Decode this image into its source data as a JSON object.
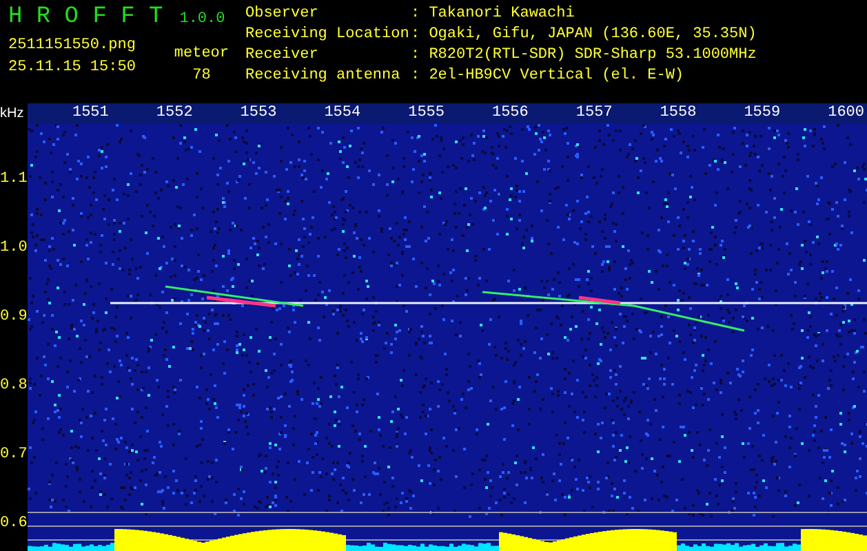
{
  "app": {
    "title": "H R O F F T",
    "version": "1.0.0"
  },
  "file": {
    "name": "2511151550.png",
    "datetime": "25.11.15 15:50"
  },
  "counter": {
    "label": "meteor",
    "count": "78"
  },
  "info": [
    {
      "label": "Observer",
      "value": ": Takanori Kawachi"
    },
    {
      "label": "Receiving Location",
      "value": ": Ogaki, Gifu, JAPAN (136.60E, 35.35N)"
    },
    {
      "label": "Receiver",
      "value": ": R820T2(RTL-SDR) SDR-Sharp 53.1000MHz"
    },
    {
      "label": "Receiving antenna",
      "value": ": 2el-HB9CV Vertical (el. E-W)"
    }
  ],
  "axis": {
    "unit": "kHz",
    "time_labels": [
      "1551",
      "1552",
      "1553",
      "1554",
      "1555",
      "1556",
      "1557",
      "1558",
      "1559",
      "1600"
    ],
    "freq_labels": [
      "1.1",
      "1.0",
      "0.9",
      "0.8",
      "0.7",
      "0.6"
    ]
  }
}
